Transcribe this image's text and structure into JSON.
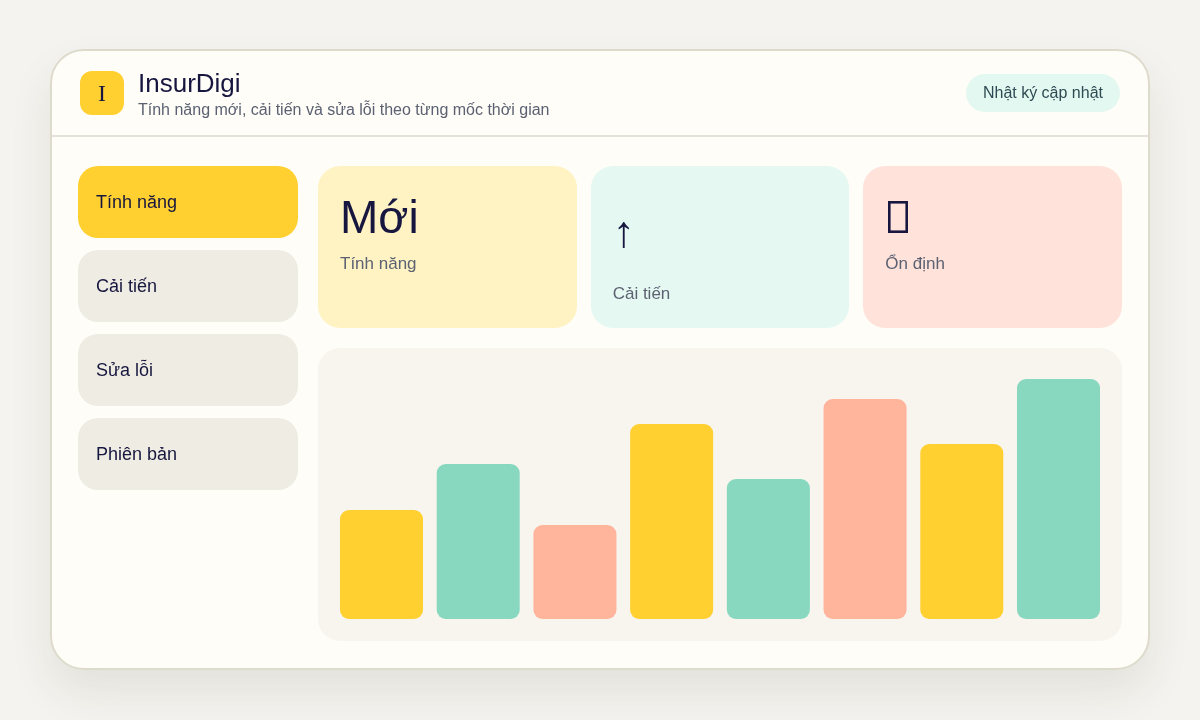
{
  "header": {
    "logo": "I",
    "title": "InsurDigi",
    "subtitle": "Tính năng mới, cải tiến và sửa lỗi theo từng mốc thời gian",
    "button": "Nhật ký cập nhật"
  },
  "sidebar": {
    "items": [
      {
        "label": "Tính năng",
        "selected": true
      },
      {
        "label": "Cải tiến",
        "selected": false
      },
      {
        "label": "Sửa lỗi",
        "selected": false
      },
      {
        "label": "Phiên bản",
        "selected": false
      }
    ]
  },
  "cards": [
    {
      "kind": "word",
      "value": "Mới",
      "label": "Tính năng",
      "color": "#fff3c4"
    },
    {
      "kind": "symbol",
      "value": "↑",
      "label": "Cải tiến",
      "color": "#e5f8f2"
    },
    {
      "kind": "icon",
      "label": "Ổn định",
      "color": "#ffe3db"
    }
  ]
}
